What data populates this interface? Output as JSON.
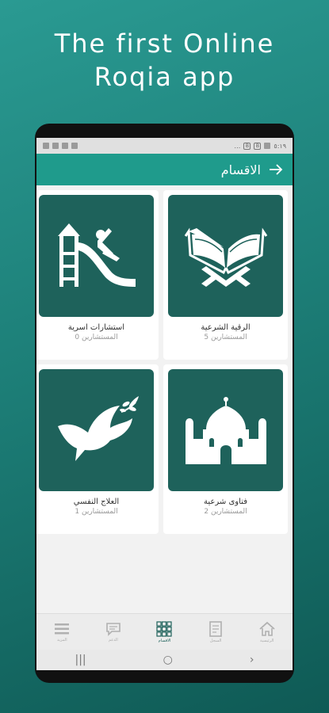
{
  "headline": {
    "line1": "The first Online",
    "line2": "Roqia app"
  },
  "status_bar": {
    "left_icons": [
      "notification-icon",
      "signal-icon",
      "wifi-icon",
      "message-icon"
    ],
    "dots": "…",
    "right_boxes": [
      "B",
      "B"
    ],
    "time": "٥:١٩"
  },
  "app_bar": {
    "title": "الاقسام",
    "back_icon": "arrow-right-icon"
  },
  "categories": [
    {
      "title": "الرقية الشرعية",
      "subtitle": "المستشارين 5",
      "icon": "quran-icon"
    },
    {
      "title": "استشارات اسرية",
      "subtitle": "المستشارين 0",
      "icon": "playground-slide-icon"
    },
    {
      "title": "فتاوى شرعية",
      "subtitle": "المستشارين 2",
      "icon": "mosque-icon"
    },
    {
      "title": "العلاج النفسي",
      "subtitle": "المستشارين 1",
      "icon": "dove-icon"
    }
  ],
  "bottom_nav": [
    {
      "label": "الرئيسية",
      "icon": "home-icon"
    },
    {
      "label": "السجل",
      "icon": "document-icon"
    },
    {
      "label": "الاقسام",
      "icon": "grid-icon",
      "active": true
    },
    {
      "label": "الدعم",
      "icon": "chat-icon"
    },
    {
      "label": "المزيد",
      "icon": "menu-icon"
    }
  ],
  "system_nav": {
    "recents": "|||",
    "home": "○",
    "back": "›"
  },
  "colors": {
    "background": "#1d7f78",
    "app_bar": "#1f9b8c",
    "tile": "#1e625b"
  }
}
